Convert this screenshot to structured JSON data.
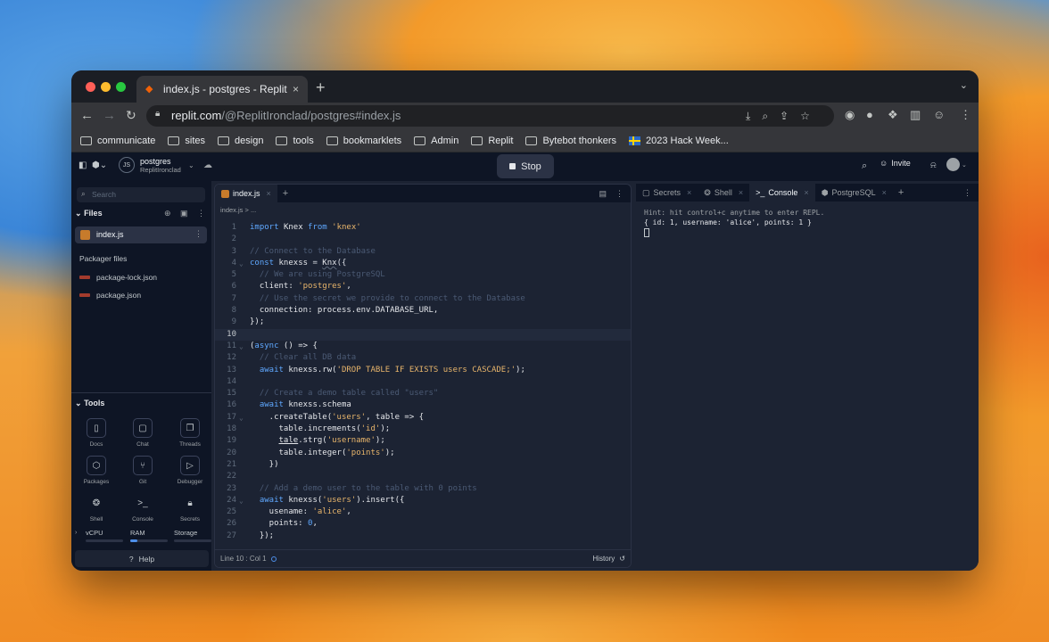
{
  "browser": {
    "tab_title": "index.js - postgres - Replit",
    "tab_close": "×",
    "new_tab": "+",
    "url_host": "replit.com",
    "url_path": "/@ReplitIronclad/postgres#index.js"
  },
  "bookmarks": [
    {
      "label": "communicate",
      "icon": "folder-icon"
    },
    {
      "label": "sites",
      "icon": "folder-icon"
    },
    {
      "label": "design",
      "icon": "folder-icon"
    },
    {
      "label": "tools",
      "icon": "folder-icon"
    },
    {
      "label": "bookmarklets",
      "icon": "folder-icon"
    },
    {
      "label": "Admin",
      "icon": "folder-icon"
    },
    {
      "label": "Replit",
      "icon": "folder-icon"
    },
    {
      "label": "Bytebot thonkers",
      "icon": "folder-icon"
    },
    {
      "label": "2023 Hack Week...",
      "icon": "flag-icon"
    }
  ],
  "header": {
    "repl_name": "postgres",
    "repl_owner": "ReplitIronclad",
    "stop_label": "Stop",
    "invite_label": "Invite"
  },
  "sidebar": {
    "search_placeholder": "Search",
    "files_title": "Files",
    "active_file": "index.js",
    "packager_title": "Packager files",
    "packager_files": [
      "package-lock.json",
      "package.json"
    ],
    "tools_title": "Tools",
    "tools": [
      "Docs",
      "Chat",
      "Threads",
      "Packages",
      "Git",
      "Debugger",
      "Shell",
      "Console",
      "Secrets"
    ],
    "resources": [
      "vCPU",
      "RAM",
      "Storage"
    ],
    "help_label": "Help"
  },
  "editor": {
    "tab_label": "index.js",
    "breadcrumb": "index.js > ...",
    "status": "Line 10 : Col 1",
    "history_label": "History"
  },
  "right_panel": {
    "tabs": [
      "Secrets",
      "Shell",
      "Console",
      "PostgreSQL"
    ],
    "active_tab": "Console",
    "console_lines": [
      "Hint: hit control+c anytime to enter REPL.",
      "{ id: 1, username: 'alice', points: 1 }"
    ]
  },
  "colors": {
    "replit_orange": "#f26207",
    "keyword_blue": "#5fa8ff",
    "string_amber": "#e8b56b"
  }
}
